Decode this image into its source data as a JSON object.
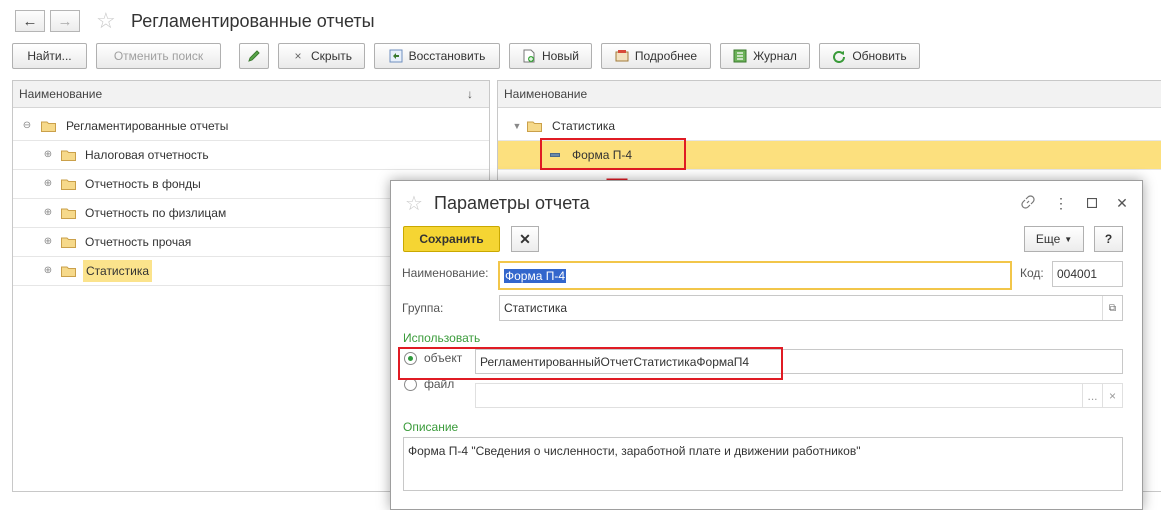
{
  "window": {
    "title": "Регламентированные отчеты"
  },
  "nav": {
    "back_icon": "←",
    "forward_icon": "→"
  },
  "toolbar": {
    "find": "Найти...",
    "cancel_search": "Отменить поиск",
    "hide": "Скрыть",
    "restore": "Восстановить",
    "new": "Новый",
    "details": "Подробнее",
    "journal": "Журнал",
    "refresh": "Обновить"
  },
  "left_pane": {
    "column_header": "Наименование",
    "sort_icon": "↓",
    "root": "Регламентированные отчеты",
    "items": [
      {
        "label": "Налоговая отчетность"
      },
      {
        "label": "Отчетность в фонды"
      },
      {
        "label": "Отчетность по физлицам"
      },
      {
        "label": "Отчетность прочая"
      },
      {
        "label": "Статистика"
      }
    ]
  },
  "right_pane": {
    "column_header": "Наименование",
    "group": "Статистика",
    "items": [
      {
        "label": "Форма П-4"
      }
    ]
  },
  "dialog": {
    "title": "Параметры отчета",
    "save_button": "Сохранить",
    "more_button": "Еще",
    "help_button": "?",
    "name_label": "Наименование:",
    "name_value": "Форма П-4",
    "code_label": "Код:",
    "code_value": "004001",
    "group_label": "Группа:",
    "group_value": "Статистика",
    "use_label": "Использовать",
    "object_option": "объект",
    "object_value": "РегламентированныйОтчетСтатистикаФормаП4",
    "file_option": "файл",
    "file_value": "",
    "file_browse": "...",
    "file_clear": "×",
    "description_label": "Описание",
    "description_value": "Форма П-4 \"Сведения о численности, заработной плате и движении работников\""
  },
  "colors": {
    "highlight": "#fbe38c",
    "highlight_row": "#fce07e",
    "save_yellow": "#f5d533",
    "annotation_red": "#e01b24",
    "group_green": "#3a9b3a"
  }
}
